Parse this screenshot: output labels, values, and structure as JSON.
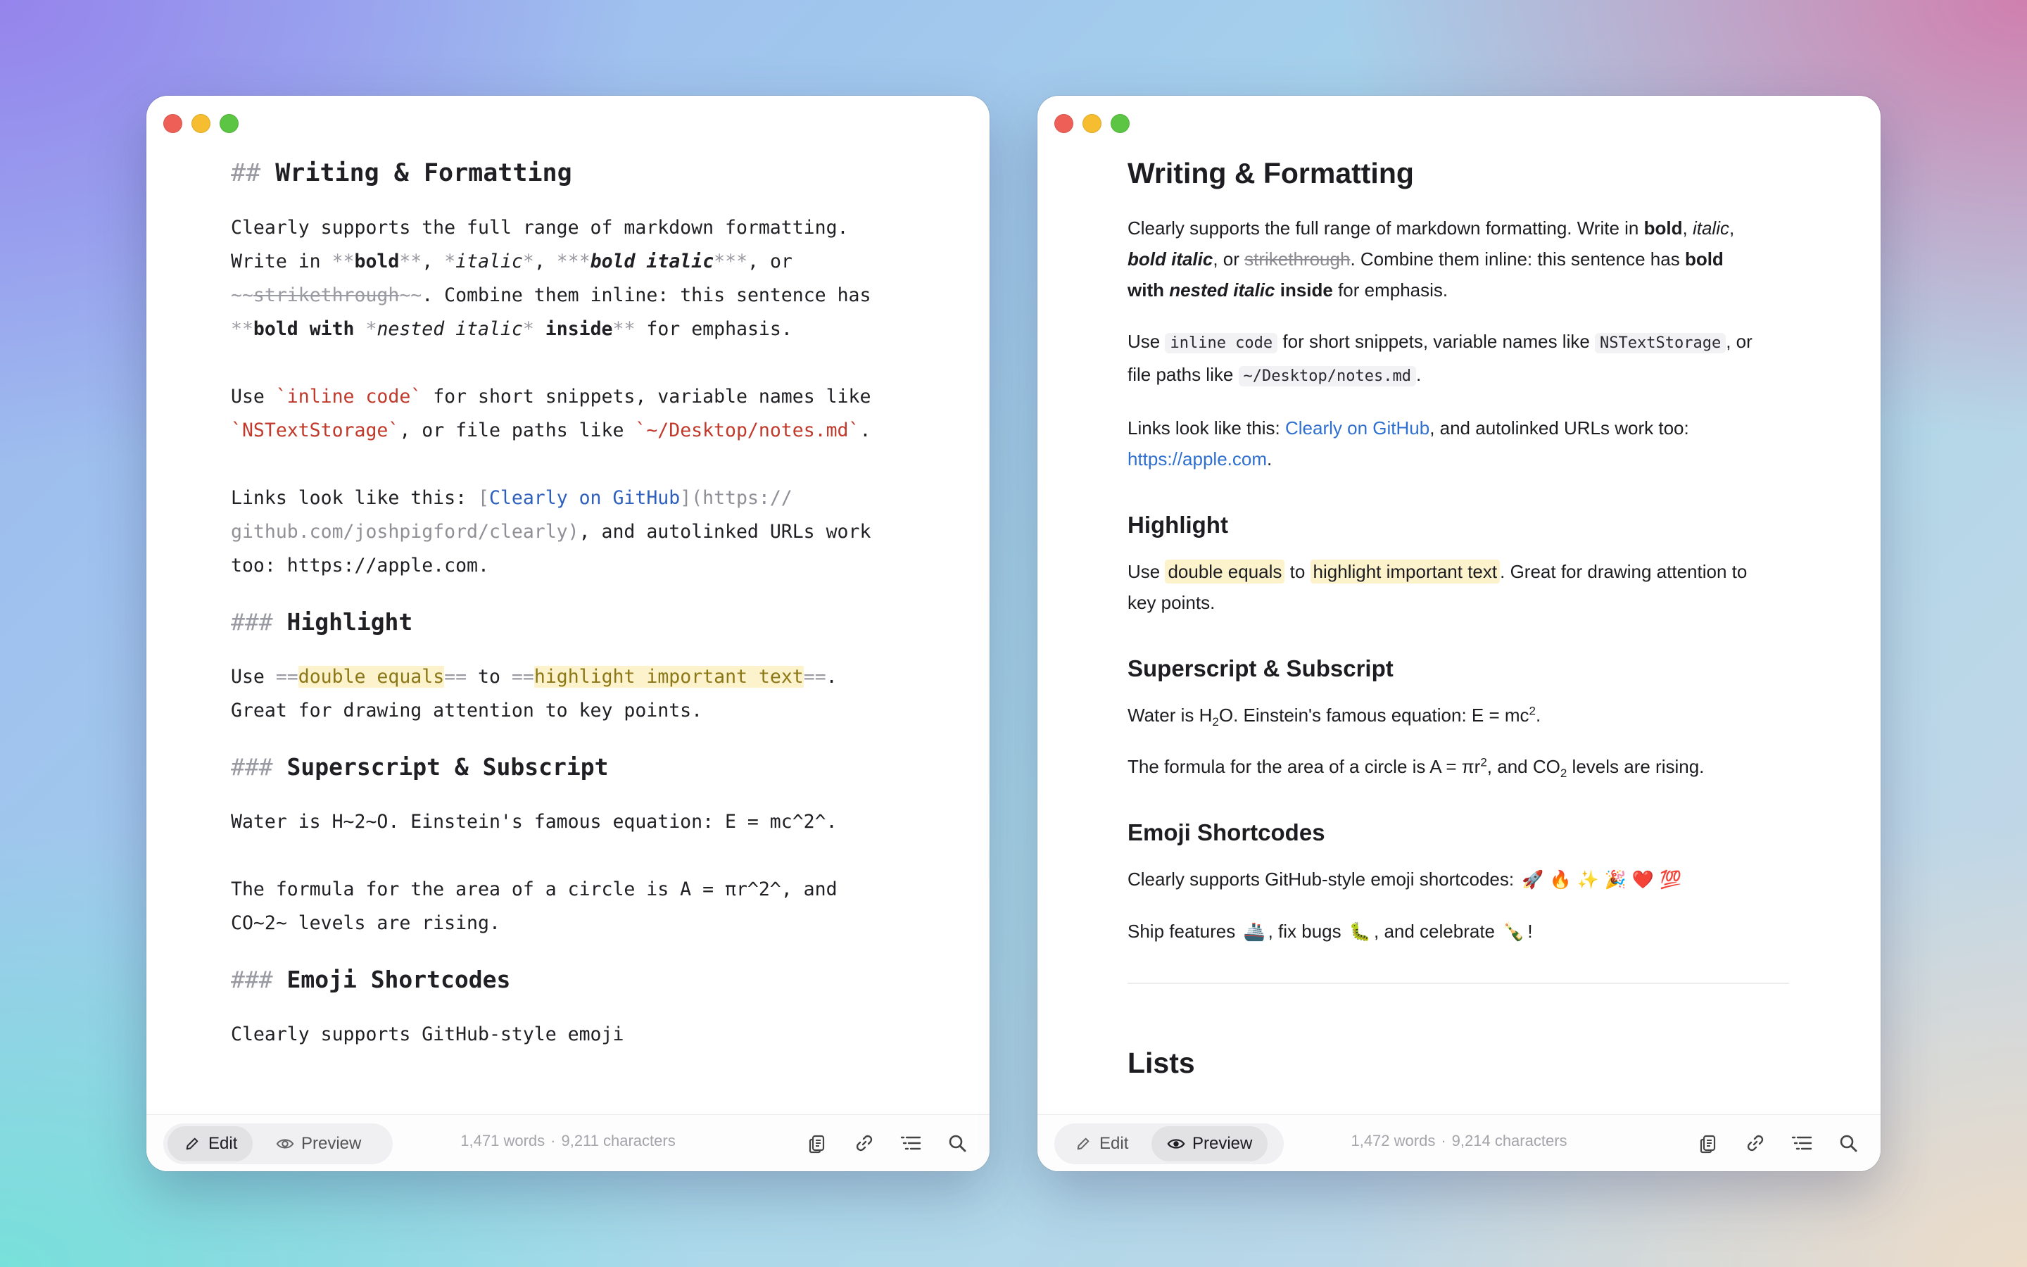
{
  "editor": {
    "h2": {
      "marker": "##",
      "text": "Writing & Formatting"
    },
    "p1": {
      "a": "Clearly supports the full range of markdown formatting.",
      "b1": "Write in ",
      "b_mk1": "**",
      "b_bold": "bold",
      "b_mk2": "**",
      "b2": ", ",
      "b_mk3": "*",
      "b_italic": "italic",
      "b_mk4": "*",
      "b3": ", ",
      "b_mk5": "***",
      "b_bi": "bold italic",
      "b_mk6": "***",
      "b4": ", or",
      "c_mk1": "~~",
      "c_strike": "strikethrough",
      "c_mk2": "~~",
      "c1": ". Combine them inline: this sentence has",
      "d_mk1": "**",
      "d_bold1": "bold with ",
      "d_mk2": "*",
      "d_it": "nested italic",
      "d_mk3": "*",
      "d_bold2": " inside",
      "d_mk4": "**",
      "d1": " for emphasis."
    },
    "p2": {
      "a1": "Use ",
      "a_code": "`inline code`",
      "a2": " for short snippets, variable names like",
      "b_code": "`NSTextStorage`",
      "b1": ", or file paths like ",
      "b_code2": "`~/Desktop/notes.md`",
      "b2": "."
    },
    "p3": {
      "a1": "Links look like this: ",
      "a_br1": "[",
      "a_link": "Clearly on GitHub",
      "a_br2": "]",
      "a_url1": "(https://",
      "b_url2": "github.com/joshpigford/clearly)",
      "b1": ", and autolinked URLs work",
      "c1": "too: https://apple.com."
    },
    "h3_highlight": {
      "marker": "###",
      "text": "Highlight"
    },
    "p4": {
      "a1": "Use ",
      "a_mk1": "==",
      "a_hl1": "double equals",
      "a_mk2": "==",
      "a2": " to ",
      "a_mk3": "==",
      "a_hl2": "highlight important text",
      "a_mk4": "==",
      "a3": ".",
      "b1": "Great for drawing attention to key points."
    },
    "h3_super": {
      "marker": "###",
      "text": "Superscript & Subscript"
    },
    "p5": "Water is H~2~O. Einstein's famous equation: E = mc^2^.",
    "p6": {
      "a": "The formula for the area of a circle is A = πr^2^, and",
      "b": "CO~2~ levels are rising."
    },
    "h3_emoji": {
      "marker": "###",
      "text": "Emoji Shortcodes"
    },
    "p7_cut": "Clearly supports GitHub-style emoji"
  },
  "preview": {
    "h2": "Writing & Formatting",
    "p1": {
      "t1": "Clearly supports the full range of markdown formatting. Write in ",
      "bold": "bold",
      "t2": ", ",
      "italic": "italic",
      "t3": ",",
      "bi": "bold italic",
      "t4": ", or ",
      "strike": "strikethrough",
      "t5": ". Combine them inline: this sentence has ",
      "bold2": "bold",
      "bold3": "with ",
      "nested": "nested italic",
      "bold4": " inside",
      "t6": " for emphasis."
    },
    "p2": {
      "t1": "Use ",
      "code1": "inline code",
      "t2": " for short snippets, variable names like ",
      "code2": "NSTextStorage",
      "t3": ", or",
      "t4": "file paths like ",
      "code3": "~/Desktop/notes.md",
      "t5": "."
    },
    "p3": {
      "t1": "Links look like this: ",
      "link": "Clearly on GitHub",
      "t2": ", and autolinked URLs work too:",
      "url": "https://apple.com",
      "t3": "."
    },
    "h3_highlight": "Highlight",
    "p4": {
      "t1": "Use ",
      "hl1": "double equals",
      "t2": " to ",
      "hl2": "highlight important text",
      "t3": ". Great for drawing attention to",
      "t4": "key points."
    },
    "h3_super": "Superscript & Subscript",
    "p5": {
      "t1": "Water is H",
      "sub1": "2",
      "t2": "O. Einstein's famous equation: E = mc",
      "sup1": "2",
      "t3": "."
    },
    "p6": {
      "t1": "The formula for the area of a circle is A = πr",
      "sup1": "2",
      "t2": ", and CO",
      "sub1": "2",
      "t3": " levels are rising."
    },
    "h3_emoji": "Emoji Shortcodes",
    "p7": {
      "t1": "Clearly supports GitHub-style emoji shortcodes: ",
      "emojis": [
        "🚀",
        "🔥",
        "✨",
        "🎉",
        "❤️",
        "💯"
      ]
    },
    "p8": {
      "t1": "Ship features ",
      "e1": "🚢",
      "t2": ", fix bugs ",
      "e2": "🐛",
      "t3": ", and celebrate ",
      "e3": "🍾",
      "t4": "!"
    },
    "h2_lists": "Lists"
  },
  "left_bar": {
    "edit": "Edit",
    "preview": "Preview",
    "words": "1,471 words",
    "sep": "·",
    "chars": "9,211 characters",
    "active": "edit"
  },
  "right_bar": {
    "edit": "Edit",
    "preview": "Preview",
    "words": "1,472 words",
    "sep": "·",
    "chars": "9,214 characters",
    "active": "preview"
  },
  "tool_icons": [
    "copy-icon",
    "link-icon",
    "outline-icon",
    "search-icon"
  ]
}
